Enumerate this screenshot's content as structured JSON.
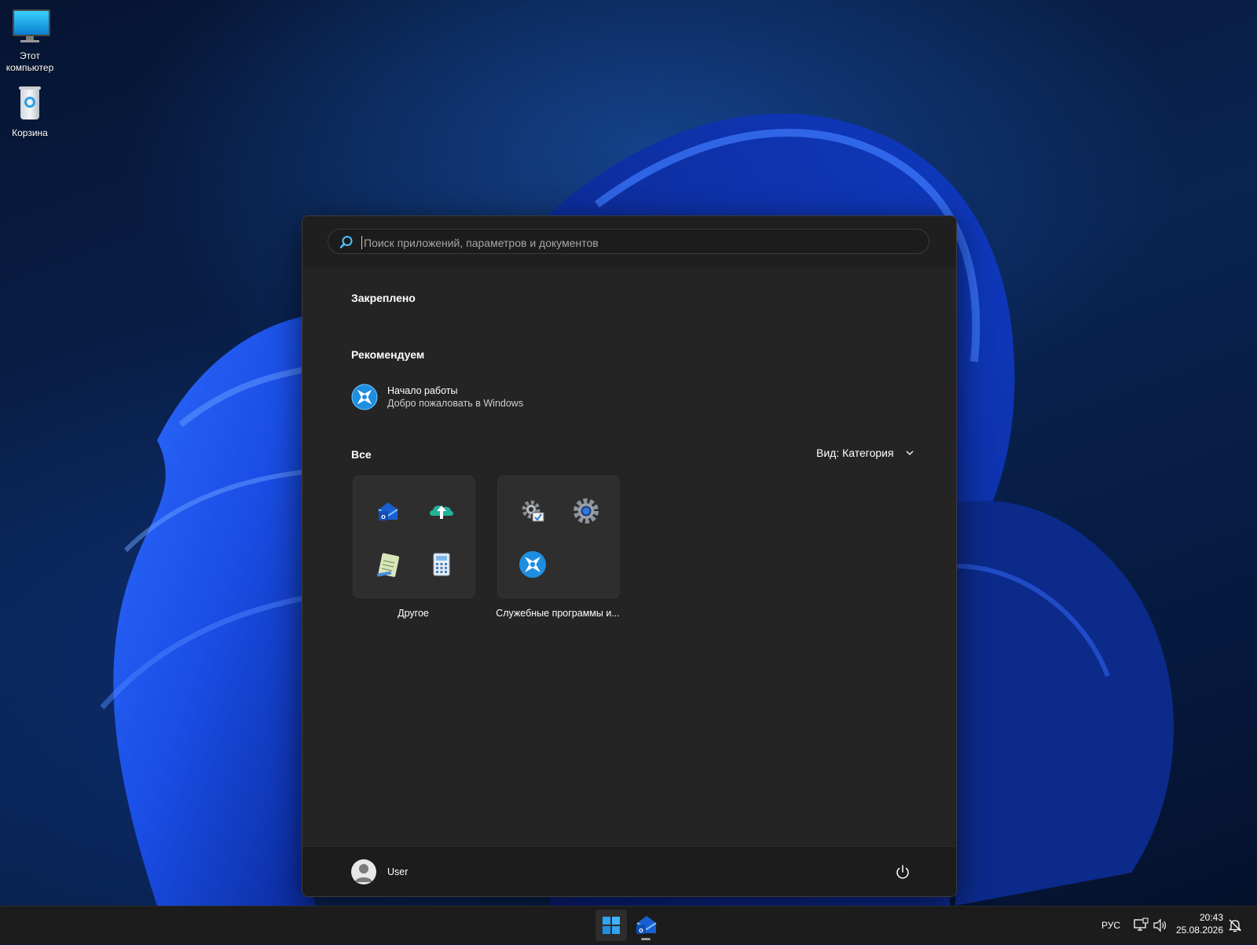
{
  "desktop": {
    "icons": [
      {
        "label_line1": "Этот",
        "label_line2": "компьютер",
        "icon": "this-pc-icon"
      },
      {
        "label": "Корзина",
        "icon": "recycle-bin-icon"
      }
    ]
  },
  "start_menu": {
    "search": {
      "placeholder": "Поиск приложений, параметров и документов",
      "value": ""
    },
    "pinned_title": "Закреплено",
    "recommended_title": "Рекомендуем",
    "recommended": [
      {
        "title": "Начало работы",
        "subtitle": "Добро пожаловать в Windows",
        "icon": "get-started-icon"
      }
    ],
    "all_title": "Все",
    "view_label": "Вид: Категория",
    "categories": [
      {
        "label": "Другое",
        "icons": [
          "outlook-icon",
          "onedrive-icon",
          "notepad-icon",
          "calculator-icon"
        ]
      },
      {
        "label": "Служебные программы и...",
        "icons": [
          "control-panel-icon",
          "settings-icon",
          "get-started-icon"
        ]
      }
    ],
    "user": {
      "name": "User"
    },
    "power_icon": "power-icon"
  },
  "taskbar": {
    "apps": [
      "start-icon",
      "outlook-icon"
    ],
    "language": "РУС",
    "time": "20:43",
    "date": "25.08.2026",
    "tray_icons": [
      "network-icon",
      "volume-icon",
      "notification-icon"
    ]
  },
  "colors": {
    "accent": "#0078d4",
    "menu_bg": "#242424",
    "taskbar_bg": "#1c1c1c"
  }
}
